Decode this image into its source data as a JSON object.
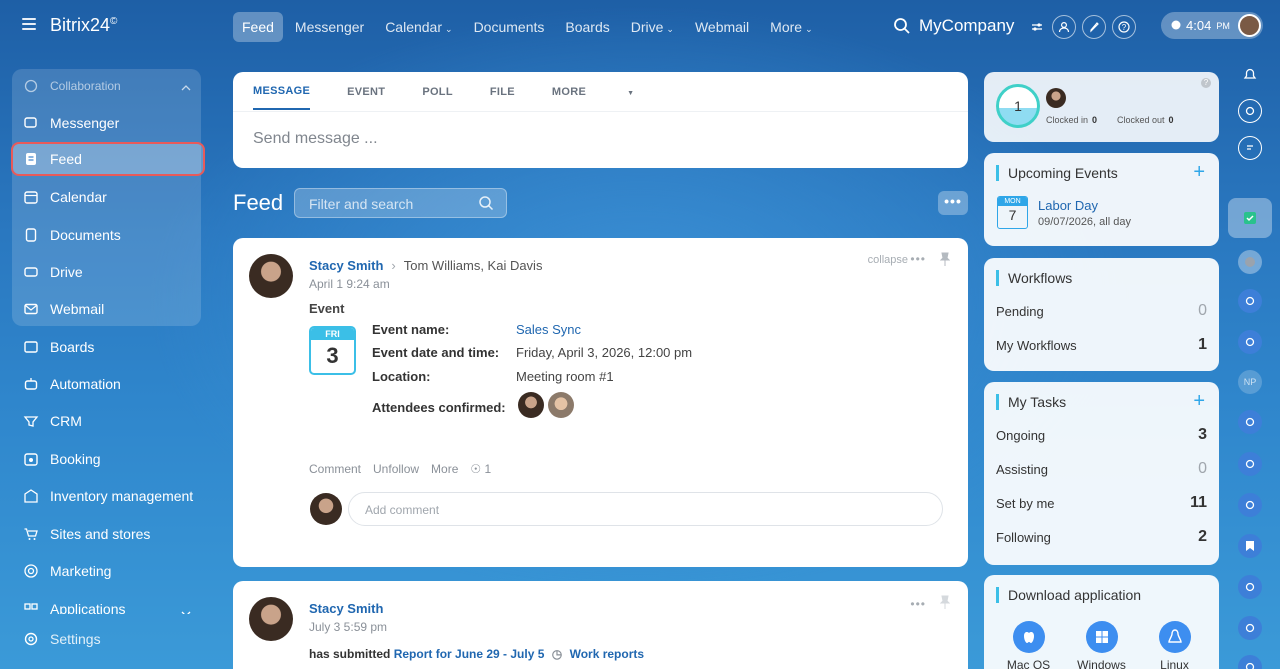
{
  "app": {
    "brand": "Bitrix24",
    "brand_mark": "©",
    "company": "MyCompany"
  },
  "nav": {
    "tabs": [
      {
        "label": "Feed",
        "active": true
      },
      {
        "label": "Messenger"
      },
      {
        "label": "Calendar",
        "dropdown": true
      },
      {
        "label": "Documents"
      },
      {
        "label": "Boards"
      },
      {
        "label": "Drive",
        "dropdown": true
      },
      {
        "label": "Webmail"
      },
      {
        "label": "More",
        "dropdown": true
      }
    ]
  },
  "clock": {
    "time": "4:04",
    "ampm": "PM"
  },
  "sidebar": {
    "group": "Collaboration",
    "group_items": [
      "Messenger",
      "Feed",
      "Calendar",
      "Documents",
      "Drive",
      "Webmail"
    ],
    "items": [
      "Boards",
      "Automation",
      "CRM",
      "Booking",
      "Inventory management",
      "Sites and stores",
      "Marketing",
      "Applications"
    ],
    "settings": "Settings",
    "active": "Feed"
  },
  "composer": {
    "tabs": [
      "MESSAGE",
      "EVENT",
      "POLL",
      "FILE",
      "MORE"
    ],
    "placeholder": "Send message ..."
  },
  "feed": {
    "title": "Feed",
    "filter_placeholder": "Filter and search",
    "more": "•••"
  },
  "post1": {
    "author": "Stacy Smith",
    "recipients": "Tom Williams, Kai Davis",
    "date": "April 1 9:24 am",
    "collapse": "collapse",
    "type": "Event",
    "cal": {
      "weekday": "FRI",
      "day": "3"
    },
    "fields": [
      {
        "label": "Event name:",
        "value": "Sales Sync",
        "link": true
      },
      {
        "label": "Event date and time:",
        "value": "Friday, April 3, 2026, 12:00 pm"
      },
      {
        "label": "Location:",
        "value": "Meeting room #1"
      },
      {
        "label": "Attendees confirmed:",
        "value": ""
      }
    ],
    "actions": {
      "comment": "Comment",
      "unfollow": "Unfollow",
      "more": "More",
      "views": "1"
    },
    "comment_placeholder": "Add comment"
  },
  "post2": {
    "author": "Stacy Smith",
    "date": "July 3 5:59 pm",
    "text": "has submitted",
    "report": "Report for June 29 - July 5",
    "work_reports": "Work reports"
  },
  "right": {
    "clock": {
      "count": "1",
      "in_label": "Clocked in",
      "in_val": "0",
      "out_label": "Clocked out",
      "out_val": "0",
      "help": "?"
    },
    "events": {
      "title": "Upcoming Events",
      "plus": "+",
      "month": "MON",
      "day": "7",
      "name": "Labor Day",
      "date": "09/07/2026, all day"
    },
    "workflows": {
      "title": "Workflows",
      "rows": [
        {
          "label": "Pending",
          "value": "0"
        },
        {
          "label": "My Workflows",
          "value": "1"
        }
      ]
    },
    "tasks": {
      "title": "My Tasks",
      "plus": "+",
      "rows": [
        {
          "label": "Ongoing",
          "value": "3"
        },
        {
          "label": "Assisting",
          "value": "0"
        },
        {
          "label": "Set by me",
          "value": "11"
        },
        {
          "label": "Following",
          "value": "2"
        }
      ]
    },
    "download": {
      "title": "Download application",
      "apps": [
        "Mac OS",
        "Windows",
        "Linux"
      ]
    }
  },
  "strip": {
    "np": "NP"
  },
  "colors": {
    "accent": "#2067b0",
    "active_outline": "#e85a5a",
    "calendar": "#3bbfe7"
  }
}
